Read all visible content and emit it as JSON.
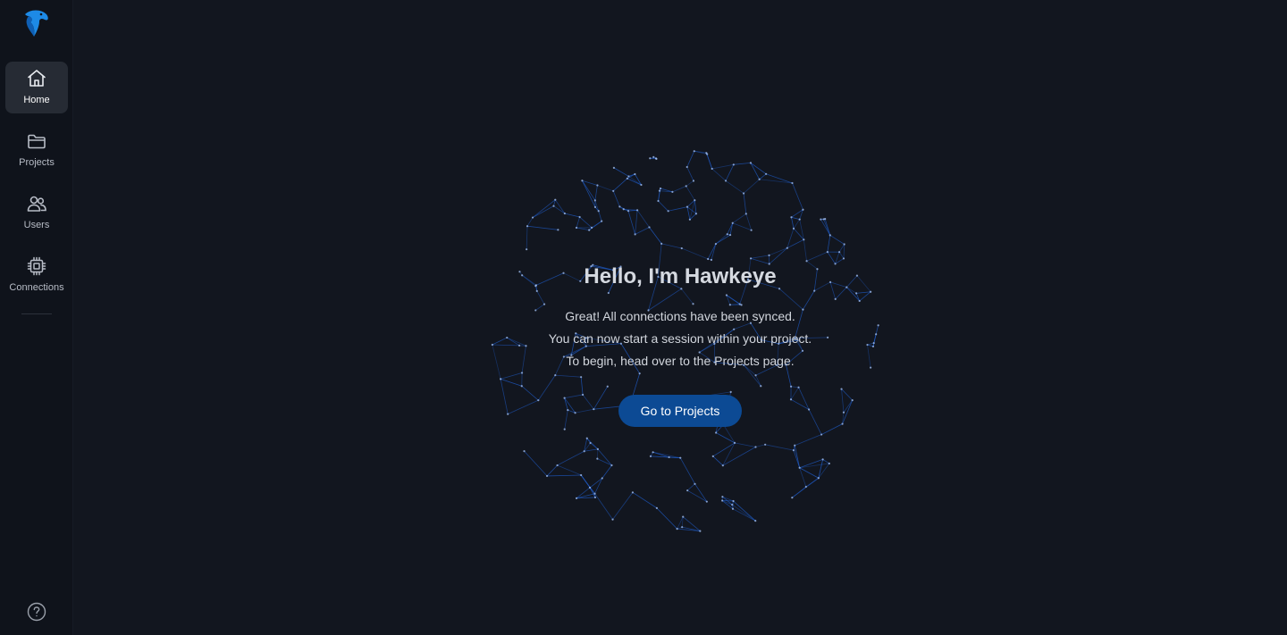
{
  "sidebar": {
    "logo_icon": "hawk-logo-icon",
    "items": [
      {
        "label": "Home",
        "icon": "home-icon",
        "active": true
      },
      {
        "label": "Projects",
        "icon": "folder-icon",
        "active": false
      },
      {
        "label": "Users",
        "icon": "users-icon",
        "active": false
      },
      {
        "label": "Connections",
        "icon": "chip-icon",
        "active": false
      }
    ],
    "help_icon": "help-circle-icon"
  },
  "main": {
    "title": "Hello, I'm Hawkeye",
    "lines": [
      "Great! All connections have been synced.",
      "You can now start a session within your project.",
      "To begin, head over to the Projects page."
    ],
    "cta_label": "Go to Projects",
    "background_graphic": "network-globe"
  },
  "colors": {
    "background": "#12161f",
    "sidebar": "#0f131b",
    "active_nav": "#262b34",
    "accent": "#0c4a94",
    "globe_line": "#1f5fd1",
    "logo": "#1d8ae6"
  }
}
